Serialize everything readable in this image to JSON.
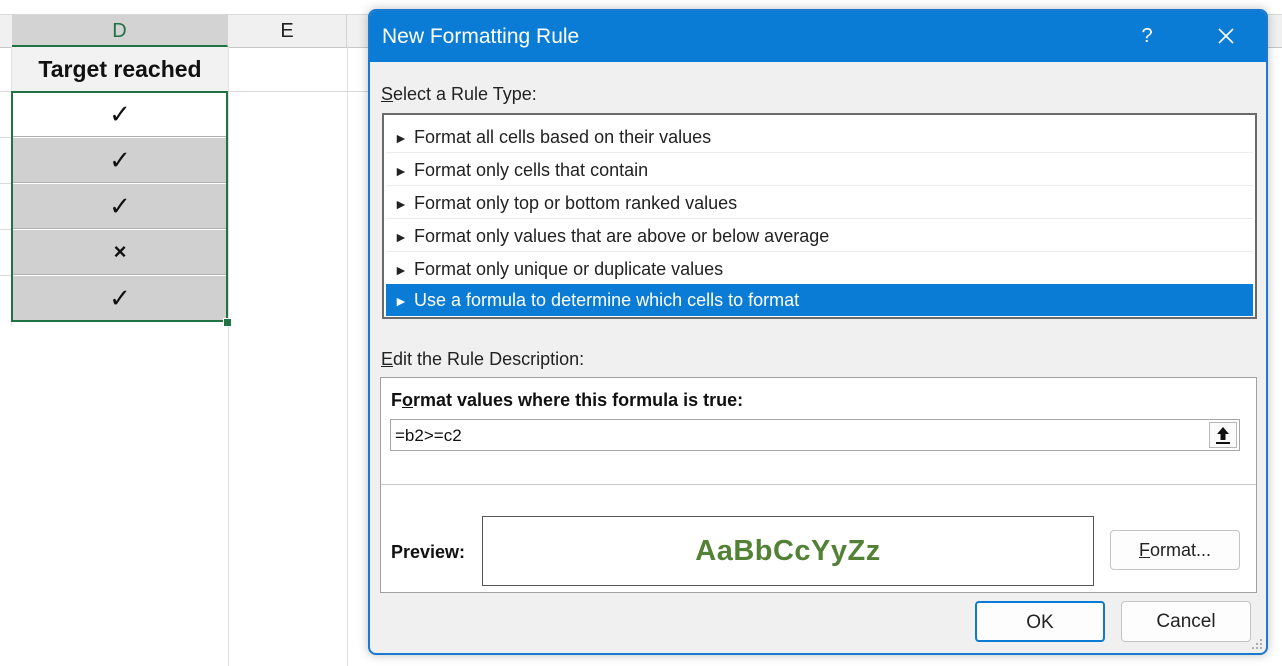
{
  "sheet": {
    "columns": [
      "D",
      "E"
    ],
    "header": "Target reached",
    "cells": [
      "✓",
      "✓",
      "✓",
      "×",
      "✓"
    ]
  },
  "dialog": {
    "title": "New Formatting Rule",
    "help": "?",
    "select_label_key": "S",
    "select_label_rest": "elect a Rule Type:",
    "rule_types": [
      "Format all cells based on their values",
      "Format only cells that contain",
      "Format only top or bottom ranked values",
      "Format only values that are above or below average",
      "Format only unique or duplicate values",
      "Use a formula to determine which cells to format"
    ],
    "selected_rule_index": 5,
    "edit_label_key": "E",
    "edit_label_rest": "dit the Rule Description:",
    "formula_label_pre": "F",
    "formula_label_key": "o",
    "formula_label_rest": "rmat values where this formula is true:",
    "formula_value": "=b2>=c2",
    "preview_label": "Preview:",
    "preview_text": "AaBbCcYyZz",
    "format_button_key": "F",
    "format_button_rest": "ormat...",
    "ok_label": "OK",
    "cancel_label": "Cancel",
    "colors": {
      "accent": "#0a7cd6",
      "preview_text": "#538135",
      "selection_border": "#217346"
    }
  }
}
